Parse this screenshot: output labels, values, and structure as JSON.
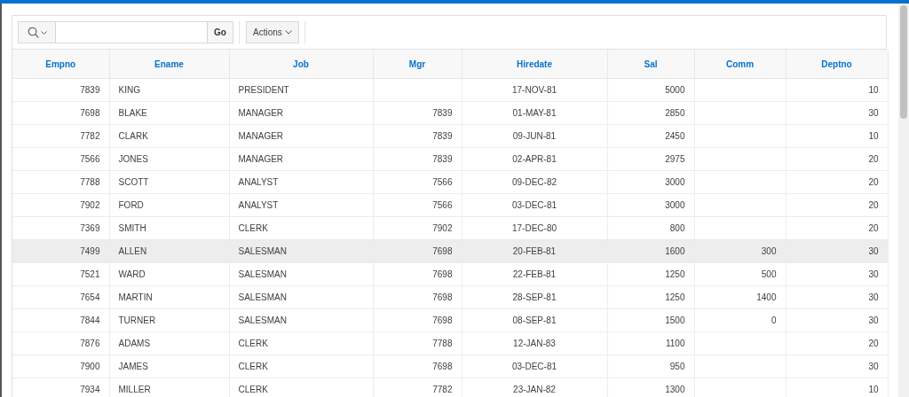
{
  "toolbar": {
    "go_button": "Go",
    "actions_button": "Actions"
  },
  "table": {
    "columns": [
      {
        "label": "Empno"
      },
      {
        "label": "Ename"
      },
      {
        "label": "Job"
      },
      {
        "label": "Mgr"
      },
      {
        "label": "Hiredate"
      },
      {
        "label": "Sal"
      },
      {
        "label": "Comm"
      },
      {
        "label": "Deptno"
      }
    ],
    "rows": [
      {
        "hovered": false,
        "cells": [
          "7839",
          "KING",
          "PRESIDENT",
          "",
          "17-NOV-81",
          "5000",
          "",
          "10"
        ]
      },
      {
        "hovered": false,
        "cells": [
          "7698",
          "BLAKE",
          "MANAGER",
          "7839",
          "01-MAY-81",
          "2850",
          "",
          "30"
        ]
      },
      {
        "hovered": false,
        "cells": [
          "7782",
          "CLARK",
          "MANAGER",
          "7839",
          "09-JUN-81",
          "2450",
          "",
          "10"
        ]
      },
      {
        "hovered": false,
        "cells": [
          "7566",
          "JONES",
          "MANAGER",
          "7839",
          "02-APR-81",
          "2975",
          "",
          "20"
        ]
      },
      {
        "hovered": false,
        "cells": [
          "7788",
          "SCOTT",
          "ANALYST",
          "7566",
          "09-DEC-82",
          "3000",
          "",
          "20"
        ]
      },
      {
        "hovered": false,
        "cells": [
          "7902",
          "FORD",
          "ANALYST",
          "7566",
          "03-DEC-81",
          "3000",
          "",
          "20"
        ]
      },
      {
        "hovered": false,
        "cells": [
          "7369",
          "SMITH",
          "CLERK",
          "7902",
          "17-DEC-80",
          "800",
          "",
          "20"
        ]
      },
      {
        "hovered": true,
        "cells": [
          "7499",
          "ALLEN",
          "SALESMAN",
          "7698",
          "20-FEB-81",
          "1600",
          "300",
          "30"
        ]
      },
      {
        "hovered": false,
        "cells": [
          "7521",
          "WARD",
          "SALESMAN",
          "7698",
          "22-FEB-81",
          "1250",
          "500",
          "30"
        ]
      },
      {
        "hovered": false,
        "cells": [
          "7654",
          "MARTIN",
          "SALESMAN",
          "7698",
          "28-SEP-81",
          "1250",
          "1400",
          "30"
        ]
      },
      {
        "hovered": false,
        "cells": [
          "7844",
          "TURNER",
          "SALESMAN",
          "7698",
          "08-SEP-81",
          "1500",
          "0",
          "30"
        ]
      },
      {
        "hovered": false,
        "cells": [
          "7876",
          "ADAMS",
          "CLERK",
          "7788",
          "12-JAN-83",
          "1100",
          "",
          "20"
        ]
      },
      {
        "hovered": false,
        "cells": [
          "7900",
          "JAMES",
          "CLERK",
          "7698",
          "03-DEC-81",
          "950",
          "",
          "30"
        ]
      },
      {
        "hovered": false,
        "cells": [
          "7934",
          "MILLER",
          "CLERK",
          "7782",
          "23-JAN-82",
          "1300",
          "",
          "10"
        ]
      }
    ]
  }
}
